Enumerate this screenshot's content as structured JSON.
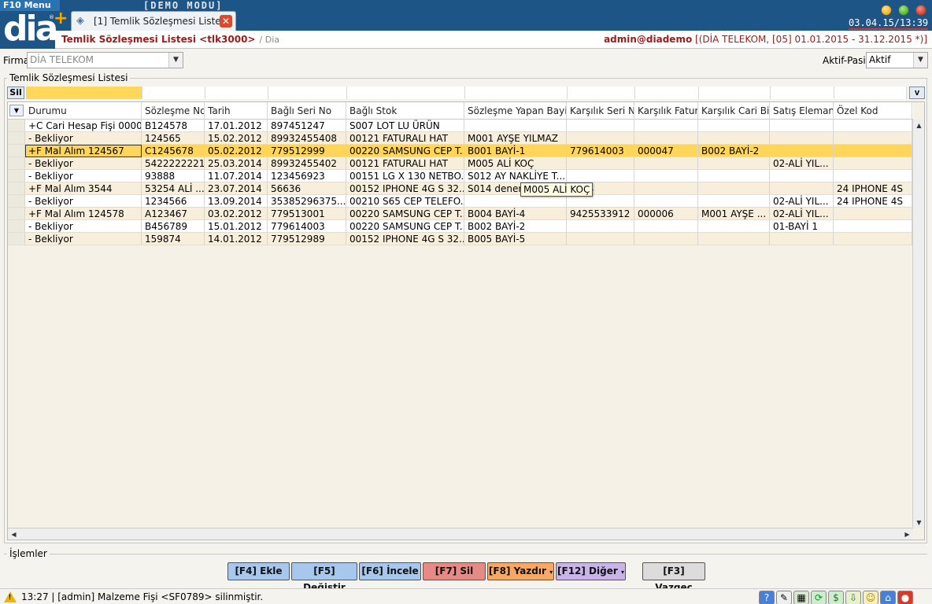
{
  "app": {
    "menu_label": "F10 Menu",
    "mode_label": "[DEMO   MODU]",
    "logo_text": "dia",
    "logo_mark": "®",
    "new_tab_symbol": "+",
    "clock": "03.04.15/13:39"
  },
  "tab": {
    "label": "[1] Temlik Sözleşmesi Listesi",
    "close_symbol": "✕"
  },
  "header": {
    "title": "Temlik Sözleşmesi Listesi <tlk3000>",
    "breadcrumb": "/ Dia",
    "user": "admin@diademo",
    "context": "[(DİA TELEKOM, [05] 01.01.2015 - 31.12.2015 *)]"
  },
  "filters": {
    "firma_label": "Firma",
    "firma_value": "DİA TELEKOM",
    "aktif_label": "Aktif-Pasif",
    "aktif_value": "Aktif"
  },
  "list": {
    "group_title": "Temlik Sözleşmesi Listesi",
    "sil_label": "Sil",
    "v_label": "v",
    "columns": [
      "Durumu",
      "Sözleşme No",
      "Tarih",
      "Bağlı Seri No",
      "Bağlı Stok",
      "Sözleşme Yapan Bayi",
      "Karşılık Seri No",
      "Karşılık Fatura",
      "Karşılık Cari Bilgisi",
      "Satış Elemanı",
      "Özel Kod"
    ],
    "rows": [
      [
        "+C Cari Hesap Fişi 000021",
        "B124578",
        "17.01.2012",
        "897451247",
        "S007 LOT LU ÜRÜN",
        "",
        "",
        "",
        "",
        "",
        ""
      ],
      [
        "- Bekliyor",
        "124565",
        "15.02.2012",
        "89932455408",
        "00121 FATURALI HAT",
        "M001 AYŞE YILMAZ",
        "",
        "",
        "",
        "",
        ""
      ],
      [
        "+F Mal Alım 124567",
        "C1245678",
        "05.02.2012",
        "779512999",
        "00220 SAMSUNG CEP T...",
        "B001 BAYİ-1",
        "779614003",
        "000047",
        "B002 BAYİ-2",
        "",
        ""
      ],
      [
        "- Bekliyor",
        "5422222221",
        "25.03.2014",
        "89932455402",
        "00121 FATURALI HAT",
        "M005 ALİ KOÇ",
        "",
        "",
        "",
        "02-ALİ YIL...",
        ""
      ],
      [
        "- Bekliyor",
        "93888",
        "11.07.2014",
        "123456923",
        "00151 LG X 130 NETBO...",
        "S012 AY NAKLİYE T...",
        "",
        "",
        "",
        "",
        ""
      ],
      [
        "+F Mal Alım 3544",
        "53254 ALİ ...",
        "23.07.2014",
        "56636",
        "00152 IPHONE 4G S 32...",
        "S014 deneme",
        "4454",
        "",
        "",
        "",
        "24 IPHONE 4S"
      ],
      [
        "- Bekliyor",
        "1234566",
        "13.09.2014",
        "35385296375...",
        "00210 S65 CEP TELEFO...",
        "",
        "",
        "",
        "",
        "02-ALİ YIL...",
        "24 IPHONE 4S"
      ],
      [
        "+F Mal Alım 124578",
        "A123467",
        "03.02.2012",
        "779513001",
        "00220 SAMSUNG CEP T...",
        "B004 BAYİ-4",
        "9425533912",
        "000006",
        "M001 AYŞE ...",
        "02-ALİ YIL...",
        ""
      ],
      [
        "- Bekliyor",
        "B456789",
        "15.01.2012",
        "779614003",
        "00220 SAMSUNG CEP T...",
        "B002 BAYİ-2",
        "",
        "",
        "",
        "01-BAYİ 1",
        ""
      ],
      [
        "- Bekliyor",
        "159874",
        "14.01.2012",
        "779512989",
        "00152 IPHONE 4G S 32...",
        "B005 BAYİ-5",
        "",
        "",
        "",
        "",
        ""
      ]
    ],
    "selected_row_index": 2,
    "tooltip": "M005 ALİ KOÇ"
  },
  "actions": {
    "group_title": "İşlemler",
    "add": "[F4] Ekle",
    "edit": "[F5] Değiştir",
    "inspect": "[F6] İncele",
    "delete": "[F7] Sil",
    "print": "[F8] Yazdır",
    "other": "[F12] Diğer",
    "cancel": "[F3] Vazgeç"
  },
  "status": {
    "message": "13:27 | [admin] Malzeme Fişi <SF0789> silinmiştir."
  },
  "colors": {
    "topbar": "#1d5586",
    "title_red": "#9b1b1b",
    "selected_row": "#ffd65a",
    "even_row": "#f7eedb"
  }
}
